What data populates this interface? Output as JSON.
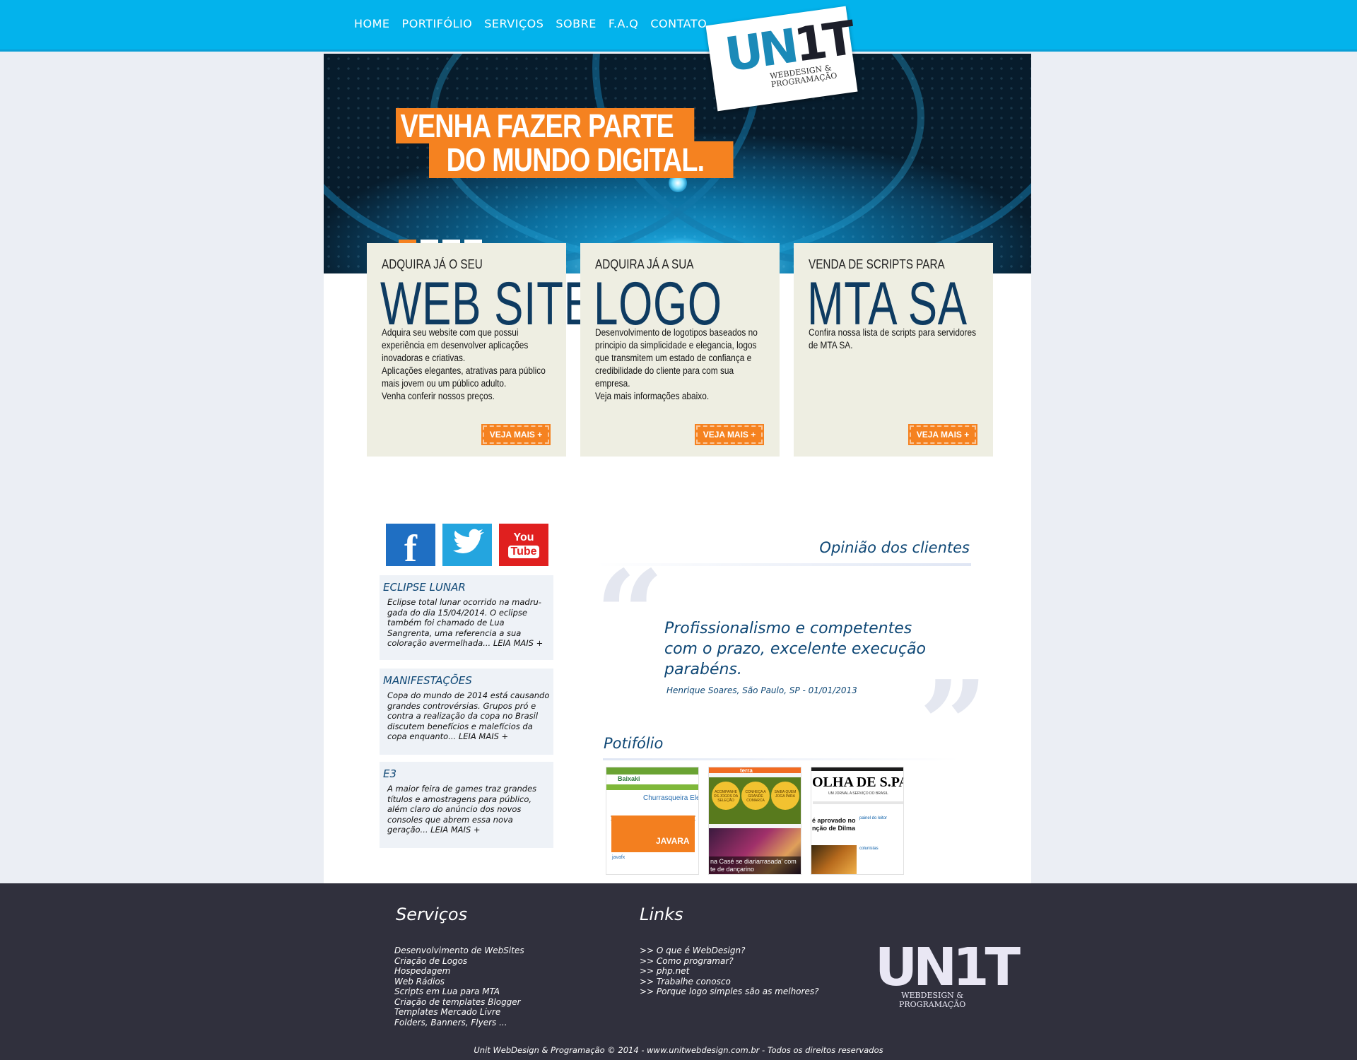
{
  "nav": [
    "HOME",
    "PORTIFÓLIO",
    "SERVIÇOS",
    "SOBRE",
    "F.A.Q",
    "CONTATO"
  ],
  "brand": {
    "mark_a": "UN",
    "mark_b": "1T",
    "tagline_1": "WEBDESIGN &",
    "tagline_2": "PROGRAMAÇÃO"
  },
  "hero": {
    "line1": "VENHA FAZER PARTE",
    "line2": "DO MUNDO DIGITAL.",
    "slides": 4,
    "active_slide": 1
  },
  "cards": [
    {
      "kicker": "ADQUIRA JÁ O SEU",
      "title": "WEB SITE",
      "lines": [
        "Adquira seu website com que possui",
        "experiência em desenvolver aplicações",
        "inovadoras e criativas.",
        "Aplicações elegantes, atrativas para público",
        "mais jovem ou um público adulto.",
        "Venha conferir nossos preços."
      ],
      "button": "VEJA MAIS +"
    },
    {
      "kicker": "ADQUIRA JÁ A SUA",
      "title": "LOGO",
      "lines": [
        "Desenvolvimento de logotipos baseados no",
        "principio da simplicidade e elegancia, logos",
        "que transmitem um estado de confiança e",
        "credibilidade do cliente para com sua empresa.",
        "Veja mais informações abaixo."
      ],
      "button": "VEJA MAIS +"
    },
    {
      "kicker": "VENDA DE SCRIPTS PARA",
      "title": "MTA SA",
      "lines": [
        "Confira nossa lista de scripts para servidores",
        "de MTA SA."
      ],
      "button": "VEJA MAIS +"
    }
  ],
  "social": {
    "facebook": "f",
    "youtube_1": "You",
    "youtube_2": "Tube"
  },
  "news": [
    {
      "title": "ECLIPSE LUNAR",
      "body": "Eclipse total lunar ocorrido na madru-gada do dia 15/04/2014. O eclipse também foi chamado de Lua Sangrenta, uma referencia a sua coloração avermelhada... LEIA MAIS +"
    },
    {
      "title": "MANIFESTAÇÕES",
      "body": "Copa do mundo de 2014 está causando grandes controvérsias. Grupos pró e contra a realização da copa no Brasil discutem benefícios e malefícios da copa enquanto... LEIA MAIS +"
    },
    {
      "title": "E3",
      "body": "A maior feira de games traz grandes títulos e amostragens para público, além claro do anúncio dos novos consoles que abrem essa nova geração... LEIA MAIS +"
    }
  ],
  "opinion": {
    "title": "Opinião dos clientes",
    "quote_1": "Profissionalismo e competentes",
    "quote_2": "com o prazo, excelente execução",
    "quote_3": "parabéns.",
    "author": "Henrique Soares, São Paulo, SP - 01/01/2013"
  },
  "portfolio": {
    "title": "Potifólio",
    "thumb1": {
      "brand": "Baixaki",
      "heading": "Churrasqueira Eletrica Ar",
      "badge": "JAVARA",
      "footer": "javafx"
    },
    "thumb2": {
      "brand": "terra",
      "ball1": "ACOMPANHE OS JOGOS DA SELEÇÃO",
      "ball2": "CONHEÇA A GRANDE COMARCA",
      "ball3": "SAIBA QUEM JOGA PARA",
      "caption1": "na Casé se diariarrasada' com",
      "caption2": "te de dançarino"
    },
    "thumb3": {
      "masthead": "OLHA DE S.PAUI",
      "strap": "UM JORNAL A SERVIÇO DO BRASIL",
      "headline1": "é aprovado no",
      "headline2": "nção de Dilma",
      "section1": "painel do leitor",
      "section2": "colunistas"
    }
  },
  "footer": {
    "services_title": "Serviços",
    "services": [
      "Desenvolvimento de WebSites",
      "Criação de Logos",
      "Hospedagem",
      "Web Rádios",
      "Scripts em Lua para MTA",
      "Criação de templates Blogger",
      "Templates Mercado Livre",
      "Folders, Banners, Flyers ..."
    ],
    "links_title": "Links",
    "links": [
      ">> O que é WebDesign?",
      ">> Como programar?",
      ">> php.net",
      ">> Trabalhe conosco",
      ">> Porque logo simples são as melhores?"
    ],
    "logo": "UN1T",
    "logo_sub_1": "WEBDESIGN &",
    "logo_sub_2": "PROGRAMAÇÃO",
    "copyright": "Unit WebDesign & Programação © 2014 - www.unitwebdesign.com.br - Todos os direitos reservados"
  },
  "colors": {
    "topbar": "#03b3ec",
    "accent": "#f58220",
    "heading": "#0e4775",
    "card_bg": "#eeeee2",
    "footer_bg": "#30303d"
  }
}
